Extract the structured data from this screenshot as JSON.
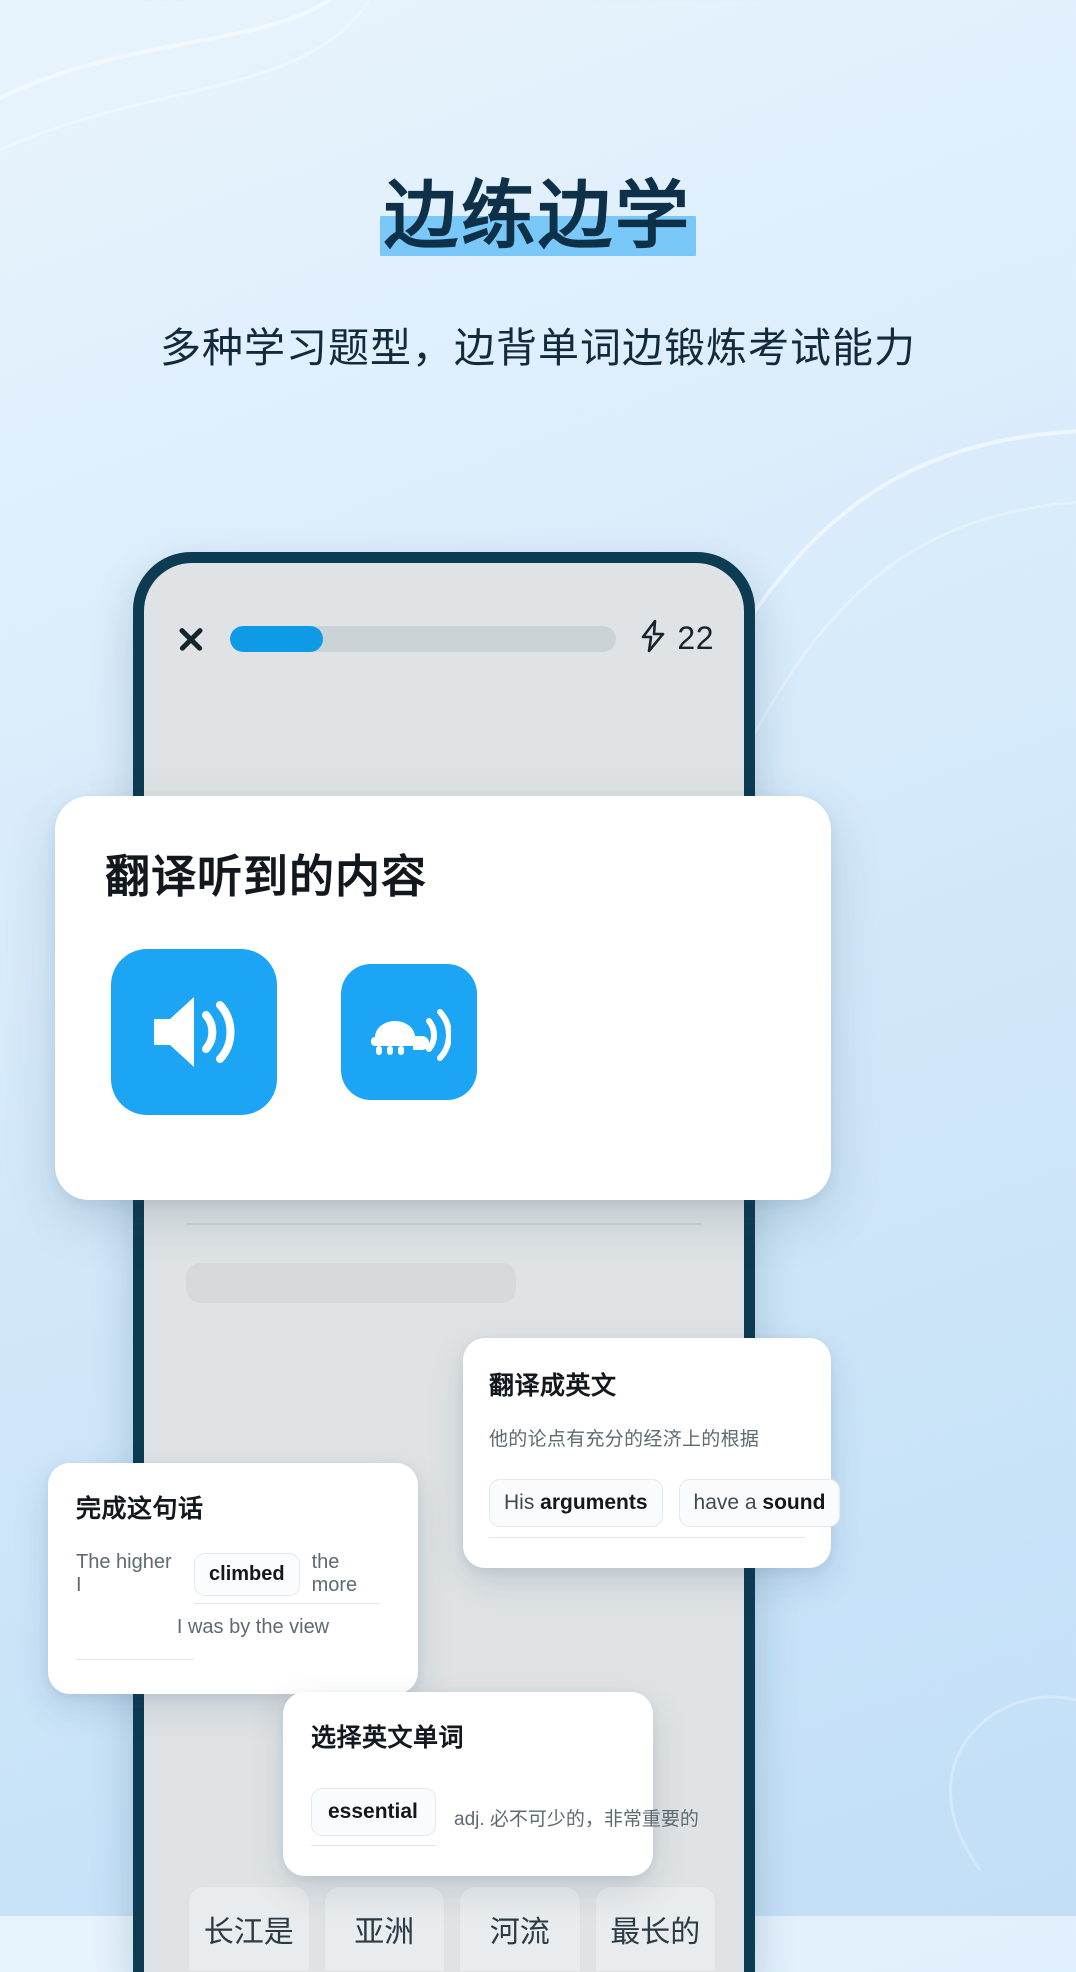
{
  "hero": {
    "title": "边练边学",
    "subtitle": "多种学习题型，边背单词边锻炼考试能力",
    "highlight_color": "#79c8f7",
    "title_color": "#0e3048"
  },
  "phone": {
    "topbar": {
      "close_icon": "close-x-icon",
      "progress_percent": 24,
      "streak_icon": "lightning-bolt-icon",
      "streak_count": "22",
      "progress_fill_color": "#0f9ae6"
    },
    "answer_choices": [
      "长江是",
      "亚洲",
      "河流",
      "最长的"
    ]
  },
  "cards": {
    "listening": {
      "title": "翻译听到的内容",
      "play_icon": "speaker-wave-icon",
      "slow_play_icon": "turtle-speaker-icon",
      "accent_color": "#1ca4f5"
    },
    "translate_to_english": {
      "title": "翻译成英文",
      "prompt": "他的论点有充分的经济上的根据",
      "chips": [
        {
          "plain": "His ",
          "bold": "arguments"
        },
        {
          "plain": "have a ",
          "bold": "sound"
        }
      ]
    },
    "complete_sentence": {
      "title": "完成这句话",
      "before": "The higher I",
      "answer": "climbed",
      "after": "the more",
      "line2": "I was by the view"
    },
    "choose_word": {
      "title": "选择英文单词",
      "word": "essential",
      "definition": "adj. 必不可少的，非常重要的"
    }
  }
}
